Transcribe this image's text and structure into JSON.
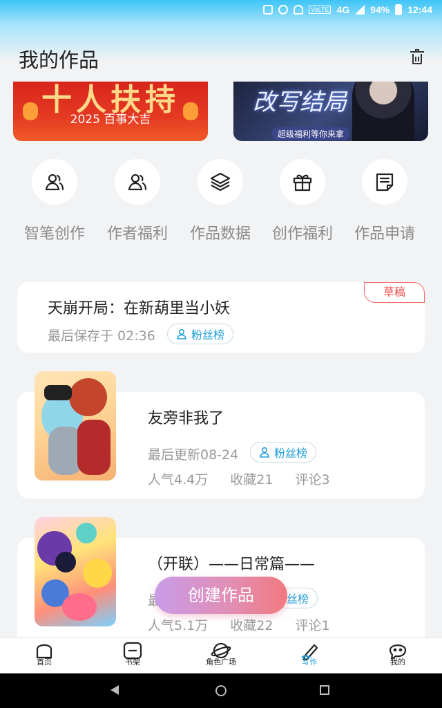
{
  "status_bar": {
    "battery": "94%",
    "time": "12:44",
    "network": "4G",
    "lte": "VoLTE"
  },
  "header": {
    "title": "我的作品",
    "trash_icon": "trash-icon"
  },
  "banners": [
    {
      "title": "十人扶持",
      "subtitle": "2025 百事大吉"
    },
    {
      "title": "改写结局",
      "subtitle": "超级福利等你来拿"
    }
  ],
  "quick_actions": [
    {
      "label": "智笔创作",
      "icon": "user-pen-icon"
    },
    {
      "label": "作者福利",
      "icon": "users-icon"
    },
    {
      "label": "作品数据",
      "icon": "layers-icon"
    },
    {
      "label": "创作福利",
      "icon": "gift-icon"
    },
    {
      "label": "作品申请",
      "icon": "document-icon"
    }
  ],
  "draft": {
    "badge": "草稿",
    "title": "天崩开局：在新葫里当小妖",
    "saved": "最后保存于 02:36",
    "fans": "粉丝榜"
  },
  "works": [
    {
      "title": "友旁非我了",
      "updated": "最后更新08-24",
      "fans": "粉丝榜",
      "popularity": "人气4.4万",
      "favorites": "收藏21",
      "comments": "评论3"
    },
    {
      "title": "（开联）——日常篇——",
      "updated": "最",
      "fans": "丝榜",
      "popularity": "人气5.1万",
      "favorites": "收藏22",
      "comments": "评论1"
    }
  ],
  "fab": {
    "label": "创建作品"
  },
  "tabs": [
    {
      "label": "首页",
      "icon": "home-icon"
    },
    {
      "label": "书架",
      "icon": "bookshelf-icon"
    },
    {
      "label": "角色广场",
      "icon": "planet-icon"
    },
    {
      "label": "写作",
      "icon": "pen-icon",
      "active": true
    },
    {
      "label": "我的",
      "icon": "chat-face-icon"
    }
  ],
  "colors": {
    "accent": "#1e9ed8",
    "draft_badge": "#f05050",
    "fab_start": "#c99ce8",
    "fab_end": "#f1797f"
  }
}
